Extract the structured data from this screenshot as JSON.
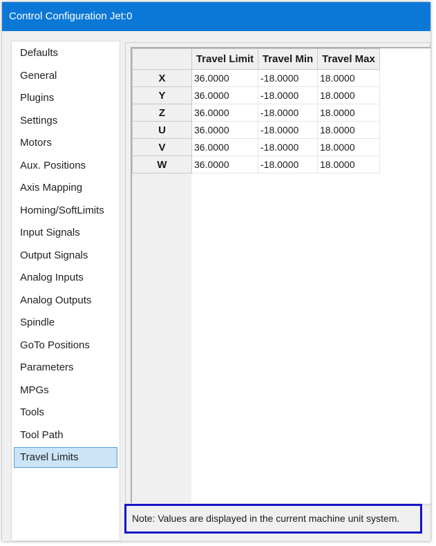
{
  "window": {
    "title": "Control Configuration Jet:0"
  },
  "sidebar": {
    "items": [
      {
        "label": "Defaults"
      },
      {
        "label": "General"
      },
      {
        "label": "Plugins"
      },
      {
        "label": "Settings"
      },
      {
        "label": "Motors"
      },
      {
        "label": "Aux. Positions"
      },
      {
        "label": "Axis Mapping"
      },
      {
        "label": "Homing/SoftLimits"
      },
      {
        "label": "Input Signals"
      },
      {
        "label": "Output Signals"
      },
      {
        "label": "Analog Inputs"
      },
      {
        "label": "Analog Outputs"
      },
      {
        "label": "Spindle"
      },
      {
        "label": "GoTo Positions"
      },
      {
        "label": "Parameters"
      },
      {
        "label": "MPGs"
      },
      {
        "label": "Tools"
      },
      {
        "label": "Tool Path"
      },
      {
        "label": "Travel Limits"
      }
    ],
    "selected": "Travel Limits"
  },
  "grid": {
    "columns": [
      "Travel Limit",
      "Travel Min",
      "Travel Max"
    ],
    "rows": [
      {
        "axis": "X",
        "values": [
          "36.0000",
          "-18.0000",
          "18.0000"
        ]
      },
      {
        "axis": "Y",
        "values": [
          "36.0000",
          "-18.0000",
          "18.0000"
        ]
      },
      {
        "axis": "Z",
        "values": [
          "36.0000",
          "-18.0000",
          "18.0000"
        ]
      },
      {
        "axis": "U",
        "values": [
          "36.0000",
          "-18.0000",
          "18.0000"
        ]
      },
      {
        "axis": "V",
        "values": [
          "36.0000",
          "-18.0000",
          "18.0000"
        ]
      },
      {
        "axis": "W",
        "values": [
          "36.0000",
          "-18.0000",
          "18.0000"
        ]
      }
    ]
  },
  "note": {
    "text": "Note: Values are displayed in the current machine unit system."
  },
  "colors": {
    "titlebar": "#0b78d7",
    "selected_bg": "#cce4f7",
    "selected_border": "#4d9fd8",
    "note_border": "#1414c8"
  }
}
